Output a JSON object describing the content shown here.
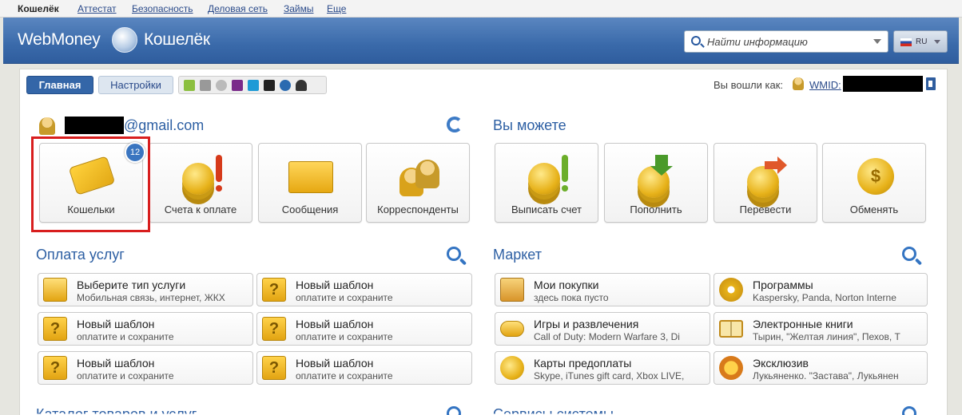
{
  "topnav": {
    "items": [
      "Кошелёк",
      "Аттестат",
      "Безопасность",
      "Деловая сеть",
      "Займы",
      "Еще"
    ]
  },
  "header": {
    "logo_left": "WebMoney",
    "logo_right": "Кошелёк",
    "search_placeholder": "Найти информацию",
    "lang": "RU"
  },
  "tabs": {
    "main": "Главная",
    "settings": "Настройки"
  },
  "platforms": [
    "android-icon",
    "apple-icon",
    "x-icon",
    "windows-phone-icon",
    "windows-icon",
    "blackberry-icon",
    "symbian-icon",
    "linux-icon"
  ],
  "login": {
    "prefix": "Вы вошли как:",
    "wmid_label": "WMID:"
  },
  "account": {
    "email_suffix": "@gmail.com"
  },
  "wallet_tiles": [
    {
      "label": "Кошельки",
      "badge": "12"
    },
    {
      "label": "Счета к оплате"
    },
    {
      "label": "Сообщения"
    },
    {
      "label": "Корреспонденты"
    }
  ],
  "can_section": {
    "title": "Вы можете"
  },
  "can_tiles": [
    {
      "label": "Выписать счет"
    },
    {
      "label": "Пополнить"
    },
    {
      "label": "Перевести"
    },
    {
      "label": "Обменять"
    }
  ],
  "payments": {
    "title": "Оплата услуг",
    "items": [
      {
        "title": "Выберите тип услуги",
        "sub": "Мобильная связь, интернет, ЖКХ"
      },
      {
        "title": "Новый шаблон",
        "sub": "оплатите и сохраните"
      },
      {
        "title": "Новый шаблон",
        "sub": "оплатите и сохраните"
      },
      {
        "title": "Новый шаблон",
        "sub": "оплатите и сохраните"
      },
      {
        "title": "Новый шаблон",
        "sub": "оплатите и сохраните"
      },
      {
        "title": "Новый шаблон",
        "sub": "оплатите и сохраните"
      }
    ]
  },
  "market": {
    "title": "Маркет",
    "items": [
      {
        "title": "Мои покупки",
        "sub": "здесь пока пусто"
      },
      {
        "title": "Программы",
        "sub": "Kaspersky, Panda, Norton Interne"
      },
      {
        "title": "Игры и развлечения",
        "sub": "Call of Duty: Modern Warfare 3, Di"
      },
      {
        "title": "Электронные книги",
        "sub": "Тырин, \"Желтая линия\", Пехов, Т"
      },
      {
        "title": "Карты предоплаты",
        "sub": "Skype, iTunes gift card, Xbox LIVE,"
      },
      {
        "title": "Эксклюзив",
        "sub": "Лукьяненко. \"Застава\", Лукьянен"
      }
    ]
  },
  "bottom": {
    "left_title": "Каталог товаров и услуг",
    "right_title": "Сервисы системы"
  },
  "colors": {
    "accent": "#2d5fa3",
    "header": "#3a6aaa",
    "highlight": "#d81e1e",
    "coin": "#e7b21a"
  }
}
